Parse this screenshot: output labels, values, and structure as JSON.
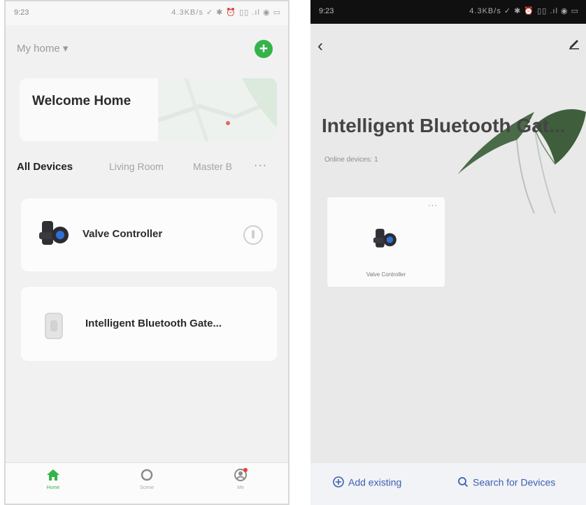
{
  "left_screen": {
    "status_bar": {
      "time": "9:23",
      "indicators": "4.3KB/s ✓ ✱ ⏰ ▯▯ .ıl ◉ ▭"
    },
    "home_selector": "My home ▾",
    "welcome_card": {
      "title": "Welcome Home"
    },
    "tabs": [
      "All Devices",
      "Living Room",
      "Master B"
    ],
    "tabs_more": "···",
    "devices": [
      {
        "name": "Valve Controller",
        "icon": "valve-icon",
        "has_power_button": true
      },
      {
        "name": "Intelligent Bluetooth Gate...",
        "icon": "gateway-icon",
        "has_power_button": false
      }
    ],
    "bottom_nav": [
      {
        "label": "Home",
        "icon": "home-icon",
        "active": true
      },
      {
        "label": "Scene",
        "icon": "scene-icon",
        "active": false
      },
      {
        "label": "Me",
        "icon": "me-icon",
        "active": false
      }
    ]
  },
  "right_screen": {
    "status_bar": {
      "time": "9:23",
      "indicators": "4.3KB/s ✓ ✱ ⏰ ▯▯ .ıl ◉ ▭"
    },
    "title": "Intelligent Bluetooth Gat...",
    "subtitle": "Online devices: 1",
    "device_tile": {
      "name": "Valve Controller",
      "more": "···"
    },
    "actions": [
      {
        "label": "Add existing",
        "icon": "add-circle-icon"
      },
      {
        "label": "Search for Devices",
        "icon": "search-icon"
      }
    ]
  },
  "colors": {
    "accent_green": "#35b34a",
    "action_blue": "#3c5fb0",
    "valve_blue": "#2f6fd6"
  }
}
